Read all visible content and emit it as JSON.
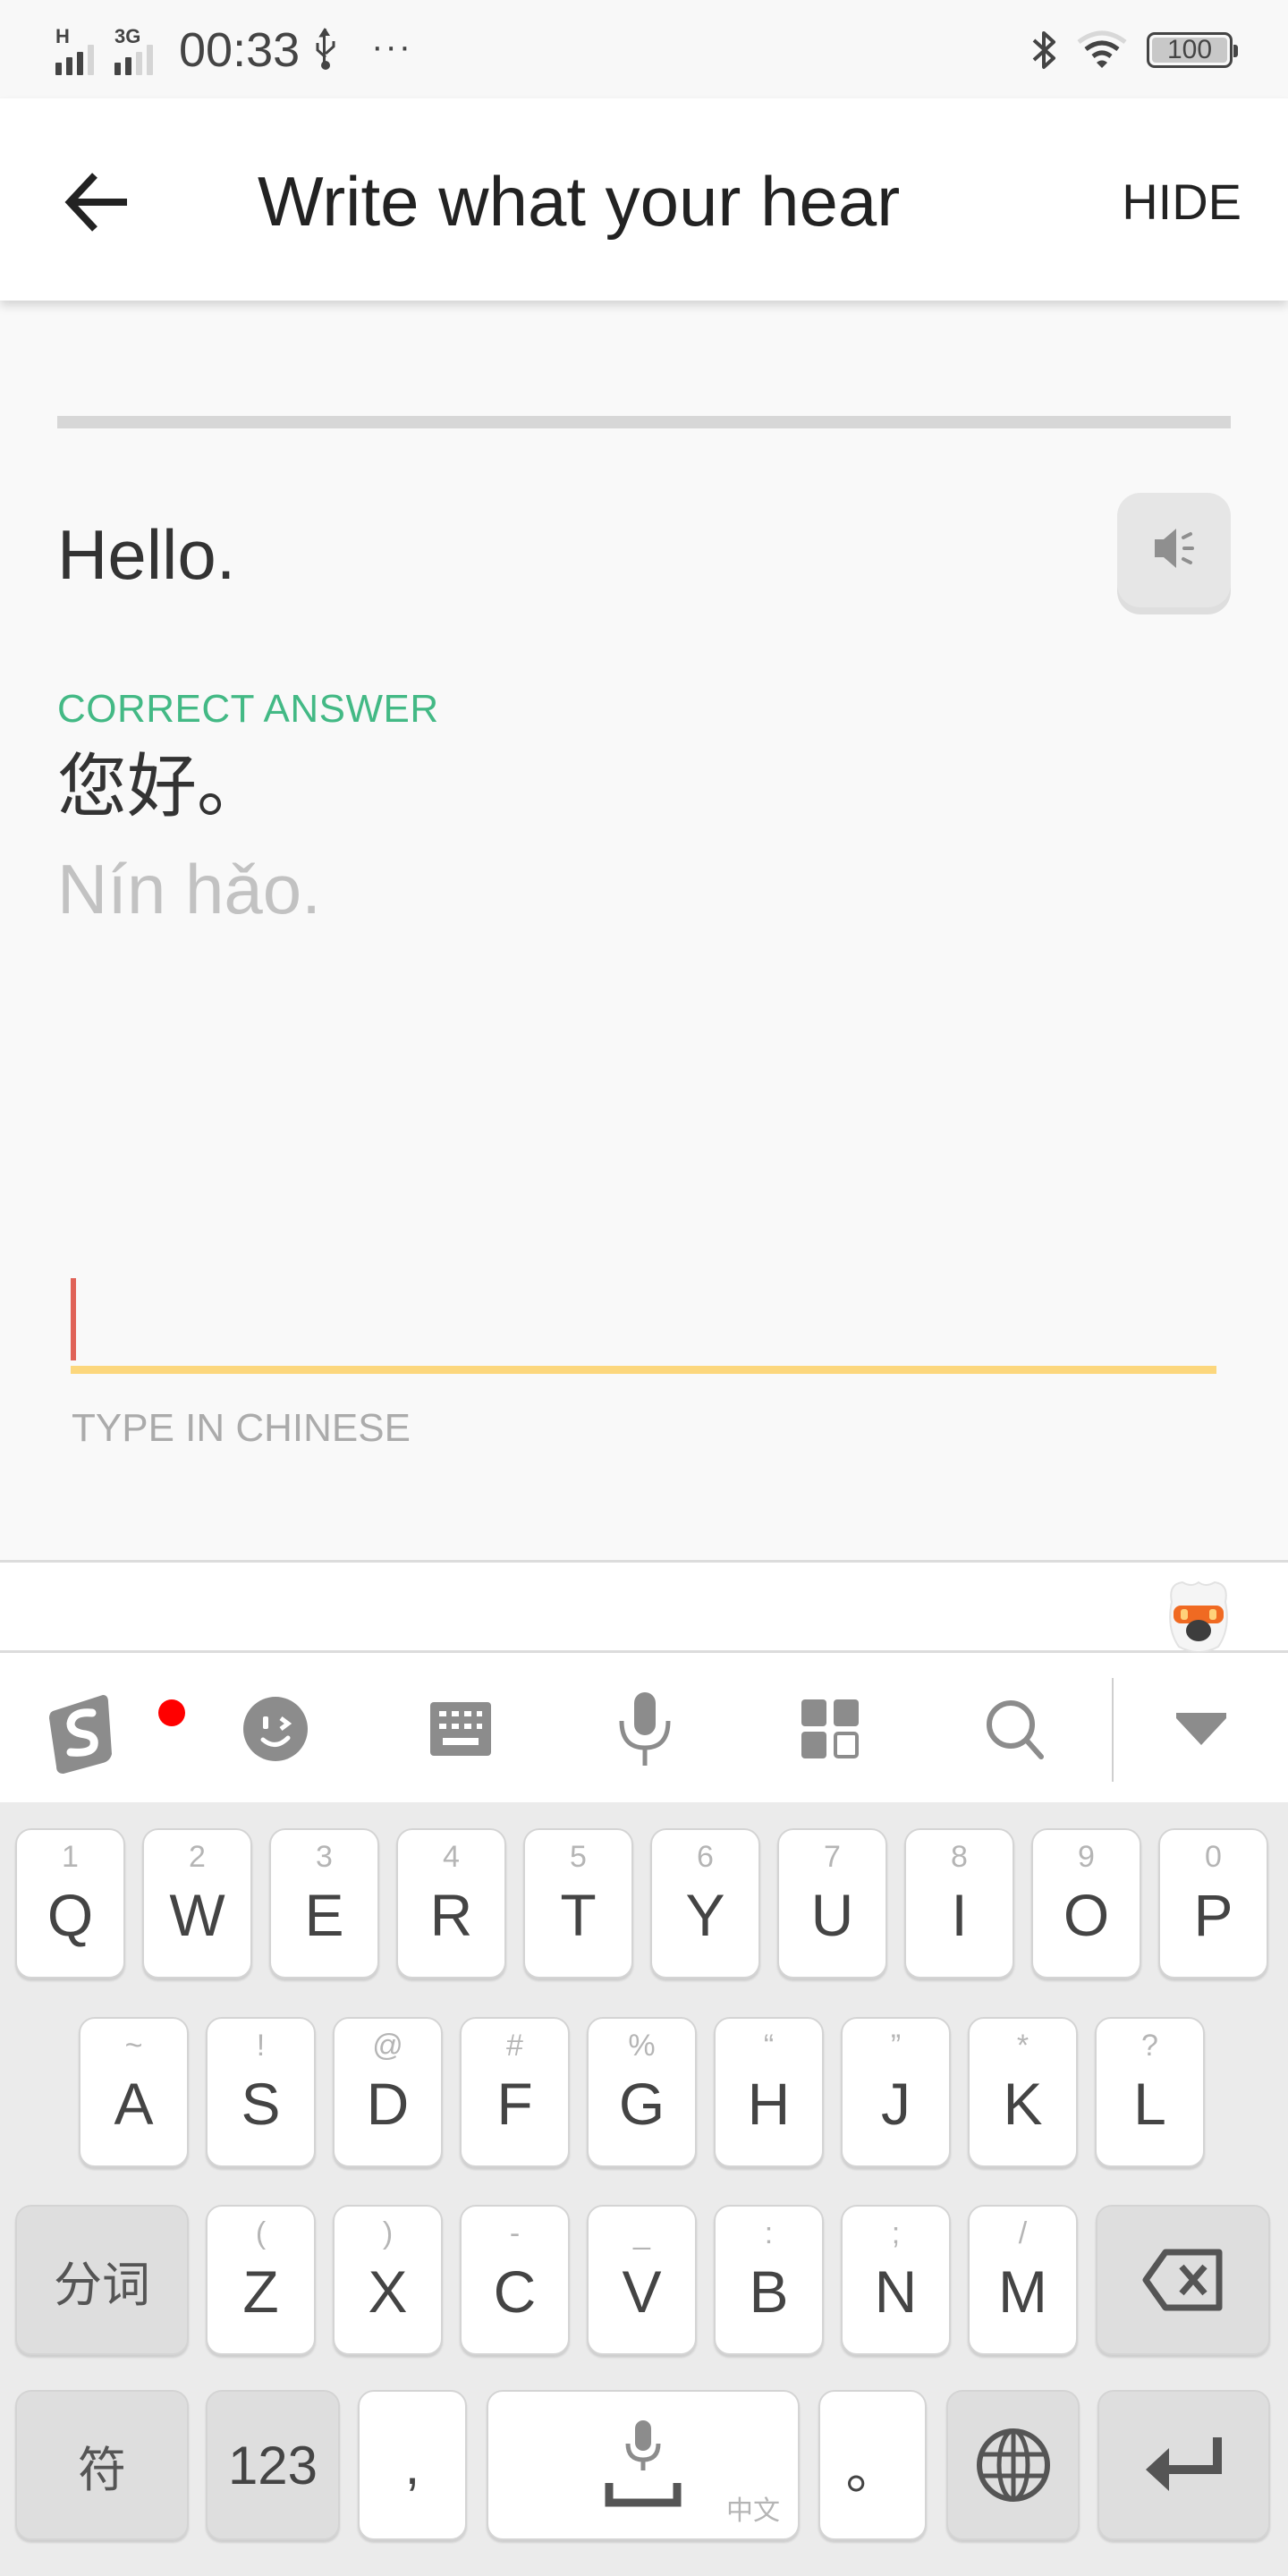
{
  "status_bar": {
    "network_1": "H",
    "network_2": "3G",
    "time": "00:33",
    "more": "···",
    "battery_level": "100",
    "icons": [
      "signal-icon",
      "usb-icon",
      "bluetooth-icon",
      "wifi-icon",
      "battery-icon"
    ]
  },
  "header": {
    "back_icon": "arrow-left-icon",
    "title": "Write what your hear",
    "hide_label": "HIDE"
  },
  "exercise": {
    "progress_percent": 0,
    "prompt": "Hello.",
    "speaker_icon": "speaker-icon",
    "correct_label": "CORRECT ANSWER",
    "answer_chinese": "您好。",
    "answer_pinyin": "Nín hǎo.",
    "input_value": "",
    "input_hint": "TYPE IN CHINESE"
  },
  "colors": {
    "correct_green": "#43b985",
    "cursor_red": "#e06358",
    "underline_yellow": "#fcd77d",
    "badge_red": "#ff0000"
  },
  "ime_toolbar": {
    "items": [
      "sogou-logo-icon",
      "emoji-icon",
      "keyboard-icon",
      "microphone-icon",
      "apps-grid-icon",
      "search-icon",
      "collapse-icon"
    ]
  },
  "keyboard": {
    "row1": [
      {
        "key": "Q",
        "sub": "1"
      },
      {
        "key": "W",
        "sub": "2"
      },
      {
        "key": "E",
        "sub": "3"
      },
      {
        "key": "R",
        "sub": "4"
      },
      {
        "key": "T",
        "sub": "5"
      },
      {
        "key": "Y",
        "sub": "6"
      },
      {
        "key": "U",
        "sub": "7"
      },
      {
        "key": "I",
        "sub": "8"
      },
      {
        "key": "O",
        "sub": "9"
      },
      {
        "key": "P",
        "sub": "0"
      }
    ],
    "row2": [
      {
        "key": "A",
        "sub": "~"
      },
      {
        "key": "S",
        "sub": "!"
      },
      {
        "key": "D",
        "sub": "@"
      },
      {
        "key": "F",
        "sub": "#"
      },
      {
        "key": "G",
        "sub": "%"
      },
      {
        "key": "H",
        "sub": "“"
      },
      {
        "key": "J",
        "sub": "”"
      },
      {
        "key": "K",
        "sub": "*"
      },
      {
        "key": "L",
        "sub": "?"
      }
    ],
    "row3": [
      {
        "key": "Z",
        "sub": "("
      },
      {
        "key": "X",
        "sub": ")"
      },
      {
        "key": "C",
        "sub": "-"
      },
      {
        "key": "V",
        "sub": "_"
      },
      {
        "key": "B",
        "sub": ":"
      },
      {
        "key": "N",
        "sub": ";"
      },
      {
        "key": "M",
        "sub": "/"
      }
    ],
    "segment_label": "分词",
    "symbols_label": "符",
    "numbers_label": "123",
    "comma_label": ",",
    "space_sub_label": "中文",
    "period_label": "。"
  }
}
